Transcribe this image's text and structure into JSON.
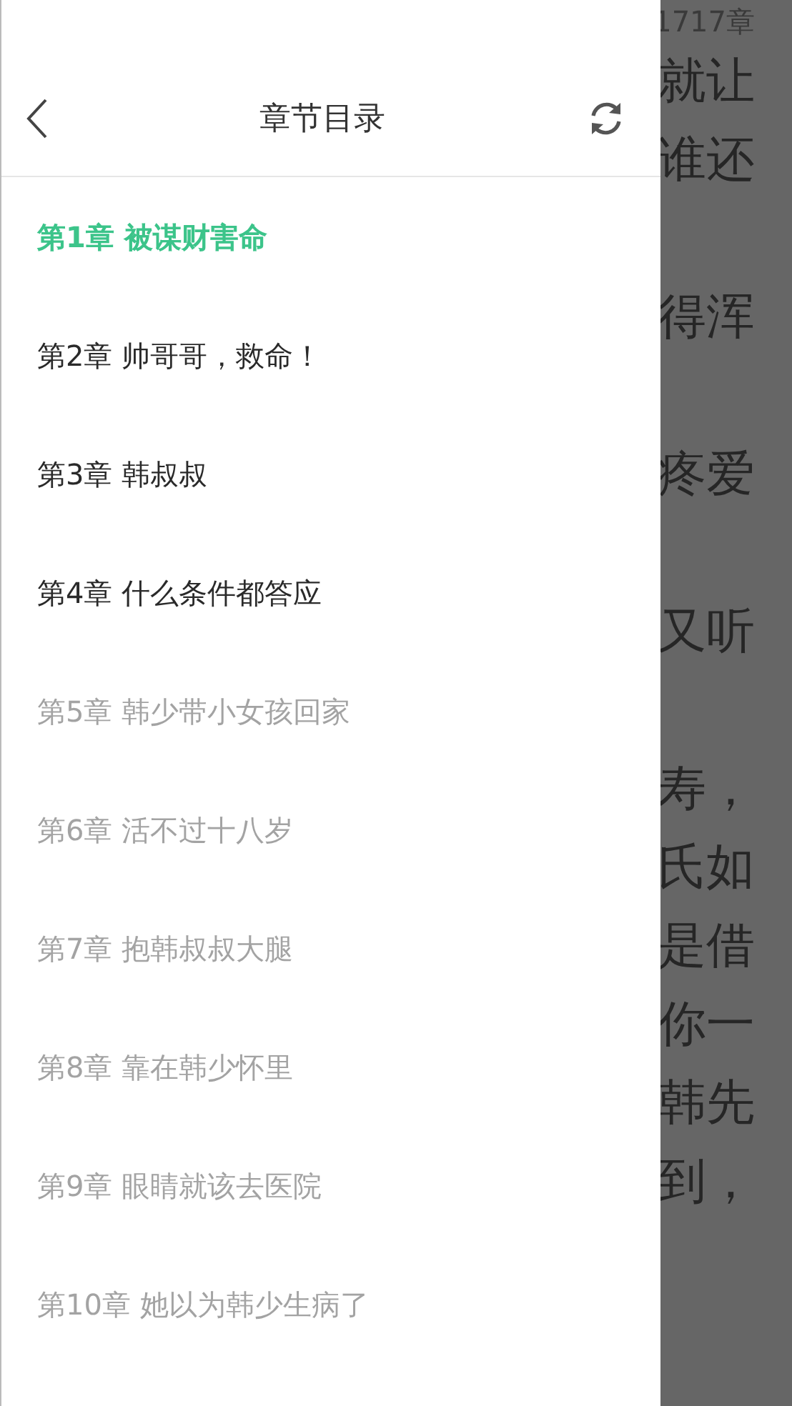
{
  "reader": {
    "chapter_indicator": "1717章",
    "paragraphs": [
      {
        "lines": [
          "就让",
          "谁还"
        ]
      },
      {
        "lines": [
          "得浑"
        ]
      },
      {
        "lines": [
          "疼爱"
        ]
      },
      {
        "lines": [
          "又听"
        ]
      },
      {
        "lines": [
          "寿，",
          "氏如",
          "是借",
          "你一",
          "韩先",
          "到，"
        ]
      }
    ]
  },
  "drawer": {
    "title": "章节目录",
    "chapters": [
      {
        "label": "第1章 被谋财害命",
        "selected": true,
        "cached": true
      },
      {
        "label": "第2章 帅哥哥，救命！",
        "selected": false,
        "cached": true
      },
      {
        "label": "第3章 韩叔叔",
        "selected": false,
        "cached": true
      },
      {
        "label": "第4章 什么条件都答应",
        "selected": false,
        "cached": true
      },
      {
        "label": "第5章 韩少带小女孩回家",
        "selected": false,
        "cached": false
      },
      {
        "label": "第6章 活不过十八岁",
        "selected": false,
        "cached": false
      },
      {
        "label": "第7章 抱韩叔叔大腿",
        "selected": false,
        "cached": false
      },
      {
        "label": "第8章 靠在韩少怀里",
        "selected": false,
        "cached": false
      },
      {
        "label": "第9章 眼睛就该去医院",
        "selected": false,
        "cached": false
      },
      {
        "label": "第10章 她以为韩少生病了",
        "selected": false,
        "cached": false
      }
    ]
  }
}
